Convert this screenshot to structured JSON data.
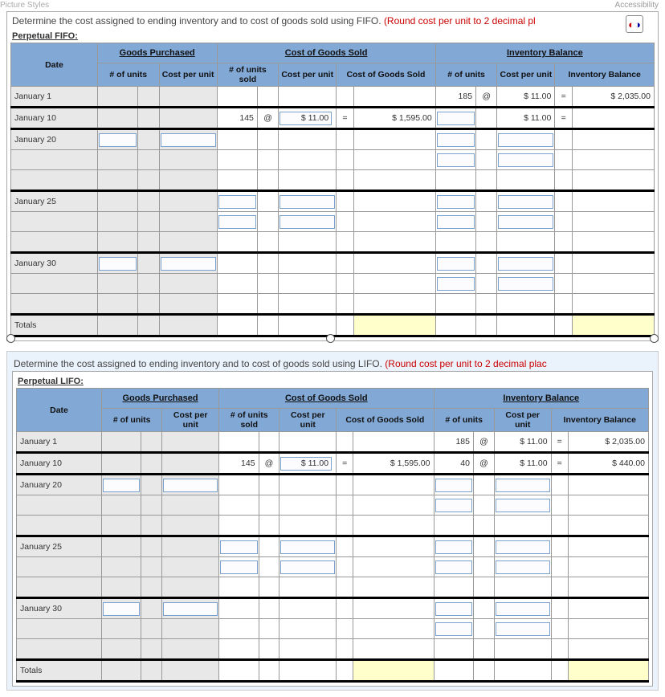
{
  "top": {
    "left_label": "Picture Styles",
    "right_label": "Accessibility"
  },
  "fifo": {
    "prompt_main": "Determine the cost assigned to ending inventory and to cost of goods sold using FIFO. ",
    "prompt_warn": "(Round cost per unit to 2 decimal pl",
    "heading": "Perpetual FIFO:",
    "groups": {
      "date": "Date",
      "purchased": "Goods Purchased",
      "cogs": "Cost of Goods Sold",
      "balance": "Inventory Balance"
    },
    "cols": {
      "p_units": "# of units",
      "p_cost": "Cost per unit",
      "s_units": "# of units sold",
      "s_cost": "Cost per unit",
      "s_total": "Cost of Goods Sold",
      "b_units": "# of units",
      "b_cost": "Cost per unit",
      "b_total": "Inventory Balance"
    },
    "rows": {
      "jan1": {
        "date": "January 1",
        "b_units": "185",
        "b_at": "@",
        "b_cost": "$  11.00",
        "b_eq": "=",
        "b_total": "$ 2,035.00"
      },
      "jan10": {
        "date": "January 10",
        "s_units": "145",
        "s_at": "@",
        "s_cost": "$ 11.00",
        "s_eq": "=",
        "s_total": "$  1,595.00",
        "b_cost": "$  11.00",
        "b_eq": "="
      },
      "jan20": {
        "date": "January 20"
      },
      "jan25": {
        "date": "January 25"
      },
      "jan30": {
        "date": "January 30"
      },
      "totals": {
        "date": "Totals"
      }
    }
  },
  "lifo": {
    "prompt_main": "Determine the cost assigned to ending inventory and to cost of goods sold using LIFO. ",
    "prompt_warn": "(Round cost per unit to 2 decimal plac",
    "heading": "Perpetual LIFO:",
    "rows": {
      "jan1": {
        "date": "January 1",
        "b_units": "185",
        "b_at": "@",
        "b_cost": "$   11.00",
        "b_eq": "=",
        "b_total": "$ 2,035.00"
      },
      "jan10": {
        "date": "January 10",
        "s_units": "145",
        "s_at": "@",
        "s_cost": "$ 11.00",
        "s_eq": "=",
        "s_total": "$  1,595.00",
        "b_units": "40",
        "b_at": "@",
        "b_cost": "$   11.00",
        "b_eq": "=",
        "b_total": "$     440.00"
      },
      "jan20": {
        "date": "January 20"
      },
      "jan25": {
        "date": "January 25"
      },
      "jan30": {
        "date": "January 30"
      },
      "totals": {
        "date": "Totals"
      }
    }
  }
}
